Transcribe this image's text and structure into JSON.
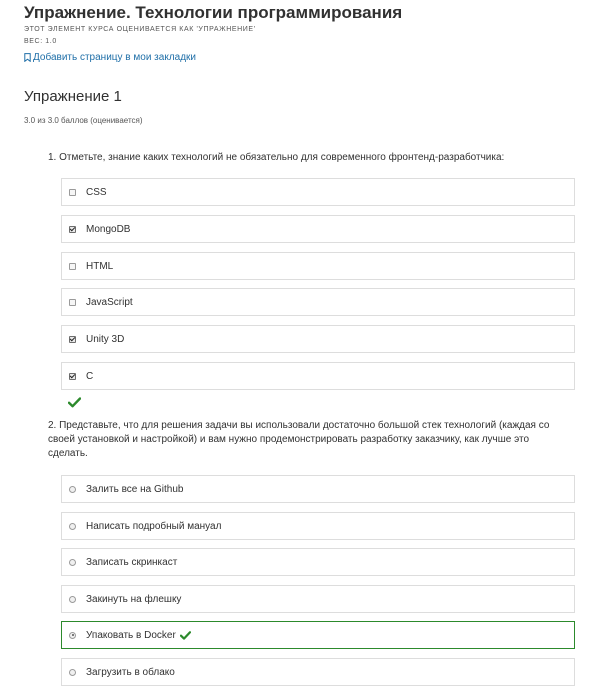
{
  "header": {
    "title": "Упражнение. Технологии программирования",
    "subtitle": "ЭТОТ ЭЛЕМЕНТ КУРСА ОЦЕНИВАЕТСЯ КАК 'УПРАЖНЕНИЕ'",
    "weight": "ВЕС: 1.0",
    "bookmark_label": "Добавить страницу в мои закладки"
  },
  "problem": {
    "title": "Упражнение 1",
    "score": "3.0 из 3.0 баллов (оценивается)"
  },
  "questions": [
    {
      "text": "1. Отметьте, знание каких технологий не обязательно для современного фронтенд-разработчика:",
      "options": [
        {
          "label": "CSS",
          "checked": false
        },
        {
          "label": "MongoDB",
          "checked": true
        },
        {
          "label": "HTML",
          "checked": false
        },
        {
          "label": "JavaScript",
          "checked": false
        },
        {
          "label": "Unity 3D",
          "checked": true
        },
        {
          "label": "C",
          "checked": true
        }
      ]
    },
    {
      "text": "2. Представьте, что для решения задачи вы использовали достаточно большой стек технологий (каждая со своей установкой и настройкой) и вам нужно продемонстрировать разработку заказчику, как лучше это сделать.",
      "options": [
        {
          "label": "Залить все на Github",
          "checked": false
        },
        {
          "label": "Написать подробный мануал",
          "checked": false
        },
        {
          "label": "Записать скринкаст",
          "checked": false
        },
        {
          "label": "Закинуть на флешку",
          "checked": false
        },
        {
          "label": "Упаковать в Docker",
          "checked": true
        },
        {
          "label": "Загрузить в облако",
          "checked": false
        }
      ]
    }
  ],
  "colors": {
    "accent_link": "#1f6fa8",
    "correct": "#2c8a2c",
    "border": "#dddddd"
  }
}
